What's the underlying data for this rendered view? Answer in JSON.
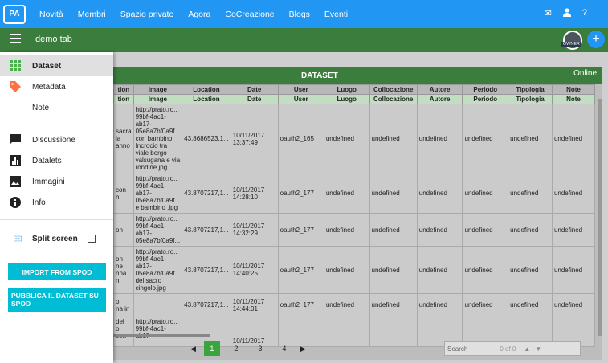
{
  "topbar": {
    "logo": "PA",
    "nav": [
      "Novità",
      "Membri",
      "Spazio privato",
      "Agora",
      "CoCreazione",
      "Blogs",
      "Eventi"
    ],
    "icons": [
      "mail-icon",
      "user-icon",
      "help-icon"
    ],
    "help_label": "?"
  },
  "greenbar": {
    "tab_title": "demo tab",
    "owner_label": "OWNER",
    "add_label": "+"
  },
  "drawer": {
    "items": [
      {
        "label": "Dataset",
        "icon": "grid-icon"
      },
      {
        "label": "Metadata",
        "icon": "tag-icon"
      },
      {
        "label": "Note",
        "icon": "note-icon"
      },
      {
        "label": "Discussione",
        "icon": "chat-icon"
      },
      {
        "label": "Datalets",
        "icon": "chart-icon"
      },
      {
        "label": "Immagini",
        "icon": "image-icon"
      },
      {
        "label": "Info",
        "icon": "info-icon"
      }
    ],
    "split_screen": "Split screen",
    "import_button": "IMPORT FROM SPOD",
    "publish_button": "PUBBLICA IL DATASET SU SPOD"
  },
  "panel": {
    "title": "DATASET",
    "status": "Online",
    "columns": [
      "",
      "Image",
      "Location",
      "Date",
      "User",
      "Luogo",
      "Collocazione",
      "Autore",
      "Periodo",
      "Tipologia",
      "Note"
    ],
    "columns2": [
      "",
      "Image",
      "Location",
      "Date",
      "User",
      "Luogo",
      "Collocazione",
      "Autore",
      "Periodo",
      "Tipologia",
      "Note"
    ],
    "col1_h1": "tion",
    "col1_h2": "tion",
    "rows": [
      {
        "c0": "sacra\nla\nanno",
        "image": "http://prato.ro... 99bf-4ac1-ab17-05e8a7bf0a9f... con bambino. Incrocio tra viale borgo valsugana e via rondine.jpg",
        "location": "43.8686523,1...",
        "date": "10/11/2017 13:37:49",
        "user": "oauth2_165",
        "luogo": "undefined",
        "coll": "undefined",
        "autore": "undefined",
        "periodo": "undefined",
        "tipologia": "undefined",
        "note": "undefined"
      },
      {
        "c0": "con\nn",
        "image": "http://prato.ro... 99bf-4ac1-ab17-05e8a7bf0a9f... e bambino .jpg",
        "location": "43.8707217,1...",
        "date": "10/11/2017 14:28:10",
        "user": "oauth2_177",
        "luogo": "undefined",
        "coll": "undefined",
        "autore": "undefined",
        "periodo": "undefined",
        "tipologia": "undefined",
        "note": "undefined"
      },
      {
        "c0": "on",
        "image": "http://prato.ro... 99bf-4ac1-ab17-05e8a7bf0a9f...",
        "location": "43.8707217,1...",
        "date": "10/11/2017 14:32:29",
        "user": "oauth2_177",
        "luogo": "undefined",
        "coll": "undefined",
        "autore": "undefined",
        "periodo": "undefined",
        "tipologia": "undefined",
        "note": "undefined"
      },
      {
        "c0": "on\nne\nnna\nn",
        "image": "http://prato.ro... 99bf-4ac1-ab17-05e8a7bf0a9f... del sacro cingolo.jpg",
        "location": "43.8707217,1...",
        "date": "10/11/2017 14:40:25",
        "user": "oauth2_177",
        "luogo": "undefined",
        "coll": "undefined",
        "autore": "undefined",
        "periodo": "undefined",
        "tipologia": "undefined",
        "note": "undefined"
      },
      {
        "c0": "o\nna in",
        "image": "",
        "location": "43.8707217,1...",
        "date": "10/11/2017 14:44:01",
        "user": "oauth2_177",
        "luogo": "undefined",
        "coll": "undefined",
        "autore": "undefined",
        "periodo": "undefined",
        "tipologia": "undefined",
        "note": "undefined"
      },
      {
        "c0": "del\no\ncon",
        "image": "http://prato.ro... 99bf-4ac1-ab17-",
        "location": "",
        "date": "10/11/2017",
        "user": "",
        "luogo": "",
        "coll": "",
        "autore": "",
        "periodo": "",
        "tipologia": "",
        "note": ""
      }
    ],
    "pager": {
      "prev": "◀",
      "pages": [
        "1",
        "2",
        "3",
        "4"
      ],
      "next": "▶"
    },
    "search": {
      "placeholder": "Search",
      "count": "0 of 0"
    }
  }
}
